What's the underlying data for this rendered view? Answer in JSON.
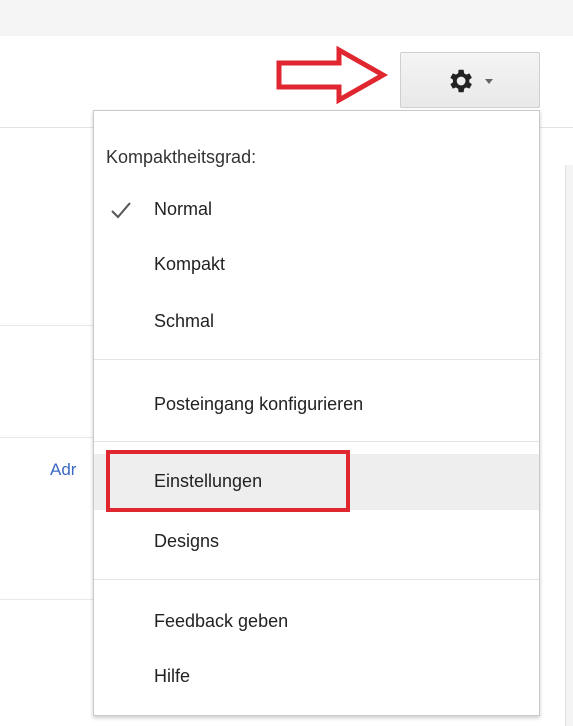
{
  "background": {
    "link_text": "Adr"
  },
  "settings_button": {
    "icon": "gear-icon",
    "dropdown_icon": "chevron-down-icon"
  },
  "menu": {
    "heading": "Kompaktheitsgrad:",
    "density_items": [
      {
        "label": "Normal",
        "selected": true
      },
      {
        "label": "Kompakt",
        "selected": false
      },
      {
        "label": "Schmal",
        "selected": false
      }
    ],
    "configure_inbox": "Posteingang konfigurieren",
    "settings": "Einstellungen",
    "themes": "Designs",
    "feedback": "Feedback geben",
    "help": "Hilfe"
  },
  "colors": {
    "annotation_red": "#e0262f",
    "link_blue": "#3b68c4",
    "hover_gray": "#eeeeee"
  }
}
